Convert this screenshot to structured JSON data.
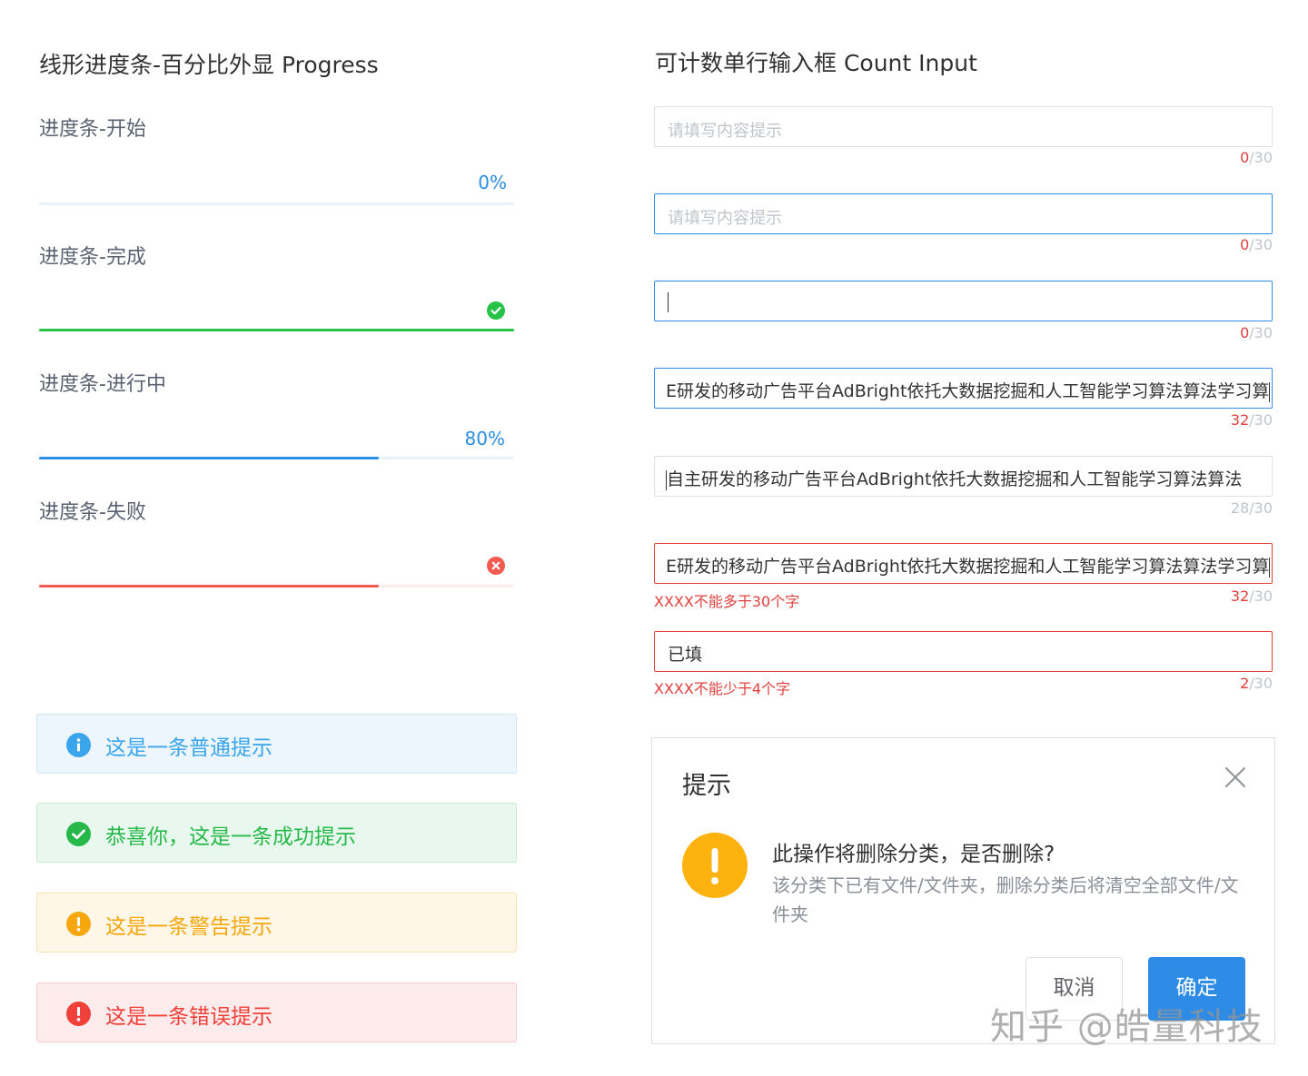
{
  "left": {
    "title": "线形进度条-百分比外显  Progress",
    "progress": [
      {
        "label": "进度条-开始",
        "text": "0%",
        "value": 0,
        "status": "normal",
        "color": "#2b8de4"
      },
      {
        "label": "进度条-完成",
        "text": "",
        "value": 100,
        "status": "success",
        "color": "#27c346"
      },
      {
        "label": "进度条-进行中",
        "text": "80%",
        "value": 71.5,
        "status": "normal",
        "color": "#2b8de4"
      },
      {
        "label": "进度条-失败",
        "text": "",
        "value": 71.5,
        "status": "error",
        "color": "#f25a4f"
      }
    ],
    "alerts": [
      {
        "text": "这是一条普通提示",
        "type": "info",
        "color": "#3aa5ec",
        "bg": "#edf6fd",
        "border": "#cfe6f8"
      },
      {
        "text": "恭喜你，这是一条成功提示",
        "type": "success",
        "color": "#27b84a",
        "bg": "#e9f8ee",
        "border": "#c6ebd1"
      },
      {
        "text": "这是一条警告提示",
        "type": "warning",
        "color": "#f5a70c",
        "bg": "#fef6e6",
        "border": "#fbe3b6"
      },
      {
        "text": "这是一条错误提示",
        "type": "error",
        "color": "#f0403a",
        "bg": "#feecec",
        "border": "#f9cccc"
      }
    ]
  },
  "right": {
    "title": "可计数单行输入框 Count Input",
    "inputs": [
      {
        "value": "",
        "placeholder": "请填写内容提示",
        "count": "0",
        "max": "/30",
        "state": "default",
        "error": ""
      },
      {
        "value": "",
        "placeholder": "请填写内容提示",
        "count": "0",
        "max": "/30",
        "state": "focus",
        "error": ""
      },
      {
        "value": "",
        "placeholder": "",
        "count": "0",
        "max": "/30",
        "state": "typing",
        "error": ""
      },
      {
        "value": "E研发的移动广告平台AdBright依托大数据挖掘和人工智能学习算法算法学习算",
        "placeholder": "",
        "count": "32",
        "max": "/30",
        "state": "focus-over",
        "error": ""
      },
      {
        "value": "自主研发的移动广告平台AdBright依托大数据挖掘和人工智能学习算法算法",
        "placeholder": "",
        "count": "28",
        "max": "/30",
        "state": "filled",
        "error": ""
      },
      {
        "value": "E研发的移动广告平台AdBright依托大数据挖掘和人工智能学习算法算法学习算",
        "placeholder": "",
        "count": "32",
        "max": "/30",
        "state": "error",
        "error": "XXXX不能多于30个字"
      },
      {
        "value": "已填",
        "placeholder": "",
        "count": "2",
        "max": "/30",
        "state": "error",
        "error": "XXXX不能少于4个字"
      }
    ],
    "dialog": {
      "title": "提示",
      "message": "此操作将删除分类，是否删除?",
      "detail": "该分类下已有文件/文件夹，删除分类后将清空全部文件/文件夹",
      "cancel": "取消",
      "confirm": "确定"
    }
  },
  "watermark": "知乎 @皓量科技",
  "colors": {
    "primary": "#2e8be6",
    "danger": "#e0403c",
    "warning": "#fdb20d",
    "success": "#27c346"
  }
}
